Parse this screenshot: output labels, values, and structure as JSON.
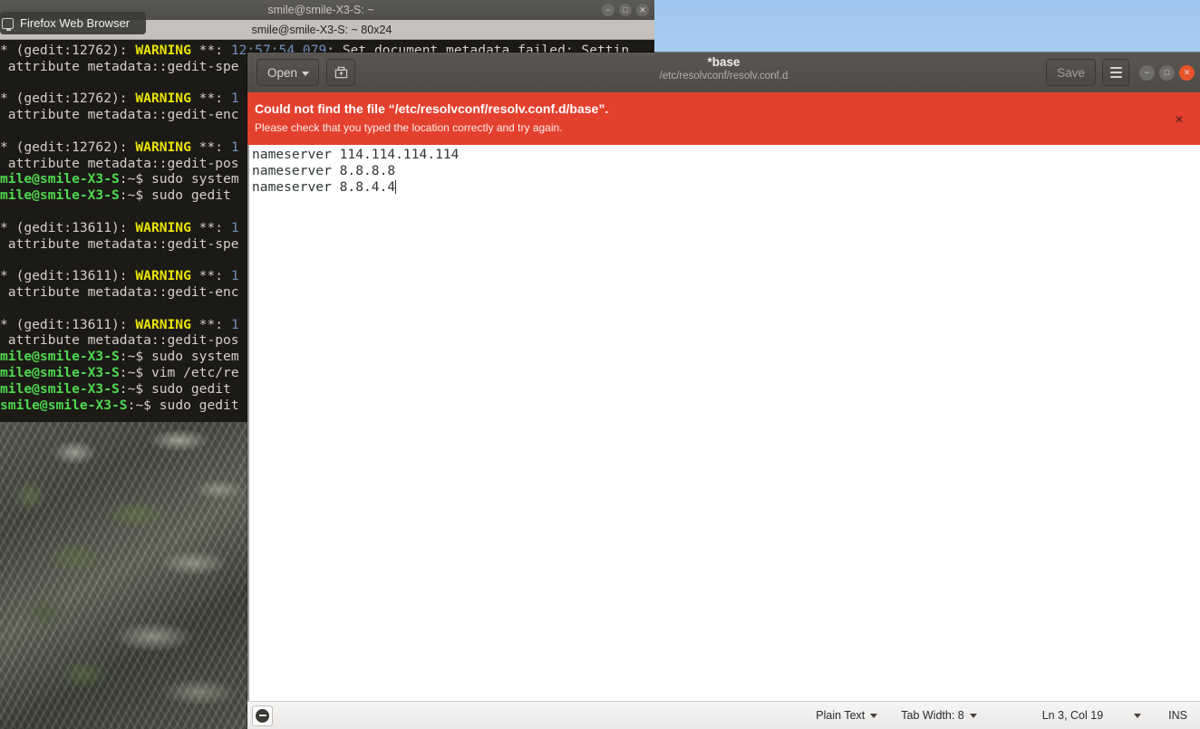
{
  "desktop": {
    "firefox_tooltip": "Firefox Web Browser"
  },
  "terminal": {
    "title": "smile@smile-X3-S: ~",
    "tab_label": "smile@smile-X3-S: ~ 80x24",
    "window_buttons": {
      "minimize": "−",
      "maximize": "□",
      "close": "✕"
    },
    "lines": [
      {
        "type": "warn",
        "prefix": "* (gedit:12762): ",
        "tag": "WARNING",
        "mid": " **: ",
        "time": "12:57:54.079",
        "rest": ": Set document metadata failed: Settin"
      },
      {
        "type": "plain",
        "text": " attribute metadata::gedit-spe"
      },
      {
        "type": "blank",
        "text": ""
      },
      {
        "type": "warn",
        "prefix": "* (gedit:12762): ",
        "tag": "WARNING",
        "mid": " **: ",
        "time": "1",
        "rest": ""
      },
      {
        "type": "plain",
        "text": " attribute metadata::gedit-enc"
      },
      {
        "type": "blank",
        "text": ""
      },
      {
        "type": "warn",
        "prefix": "* (gedit:12762): ",
        "tag": "WARNING",
        "mid": " **: ",
        "time": "1",
        "rest": ""
      },
      {
        "type": "plain",
        "text": " attribute metadata::gedit-pos"
      },
      {
        "type": "prompt",
        "user": "mile@smile-X3-S",
        "path": ":~$ ",
        "cmd": "sudo system"
      },
      {
        "type": "prompt",
        "user": "mile@smile-X3-S",
        "path": ":~$ ",
        "cmd": "sudo gedit "
      },
      {
        "type": "blank",
        "text": ""
      },
      {
        "type": "warn",
        "prefix": "* (gedit:13611): ",
        "tag": "WARNING",
        "mid": " **: ",
        "time": "1",
        "rest": ""
      },
      {
        "type": "plain",
        "text": " attribute metadata::gedit-spe"
      },
      {
        "type": "blank",
        "text": ""
      },
      {
        "type": "warn",
        "prefix": "* (gedit:13611): ",
        "tag": "WARNING",
        "mid": " **: ",
        "time": "1",
        "rest": ""
      },
      {
        "type": "plain",
        "text": " attribute metadata::gedit-enc"
      },
      {
        "type": "blank",
        "text": ""
      },
      {
        "type": "warn",
        "prefix": "* (gedit:13611): ",
        "tag": "WARNING",
        "mid": " **: ",
        "time": "1",
        "rest": ""
      },
      {
        "type": "plain",
        "text": " attribute metadata::gedit-pos"
      },
      {
        "type": "prompt",
        "user": "mile@smile-X3-S",
        "path": ":~$ ",
        "cmd": "sudo system"
      },
      {
        "type": "prompt",
        "user": "mile@smile-X3-S",
        "path": ":~$ ",
        "cmd": "vim /etc/re"
      },
      {
        "type": "prompt",
        "user": "mile@smile-X3-S",
        "path": ":~$ ",
        "cmd": "sudo gedit"
      },
      {
        "type": "prompt",
        "user": "smile@smile-X3-S",
        "path": ":~$ ",
        "cmd": "sudo gedit"
      }
    ]
  },
  "gedit": {
    "open_label": "Open",
    "save_as_icon": "save-as-icon",
    "title": "*base",
    "subtitle": "/etc/resolvconf/resolv.conf.d",
    "save_label": "Save",
    "menu_icon": "hamburger-menu-icon",
    "window_buttons": {
      "minimize": "−",
      "maximize": "□",
      "close": "✕"
    },
    "infobar": {
      "title": "Could not find the file “/etc/resolvconf/resolv.conf.d/base”.",
      "body": "Please check that you typed the location correctly and try again.",
      "close": "✕",
      "color": "#e4402e"
    },
    "document": {
      "lines": [
        "nameserver 114.114.114.114",
        "nameserver 8.8.8.8",
        "nameserver 8.8.4.4"
      ]
    },
    "statusbar": {
      "language": "Plain Text",
      "tab_width": "Tab Width: 8",
      "position": "Ln 3, Col 19",
      "insert_mode": "INS"
    }
  }
}
